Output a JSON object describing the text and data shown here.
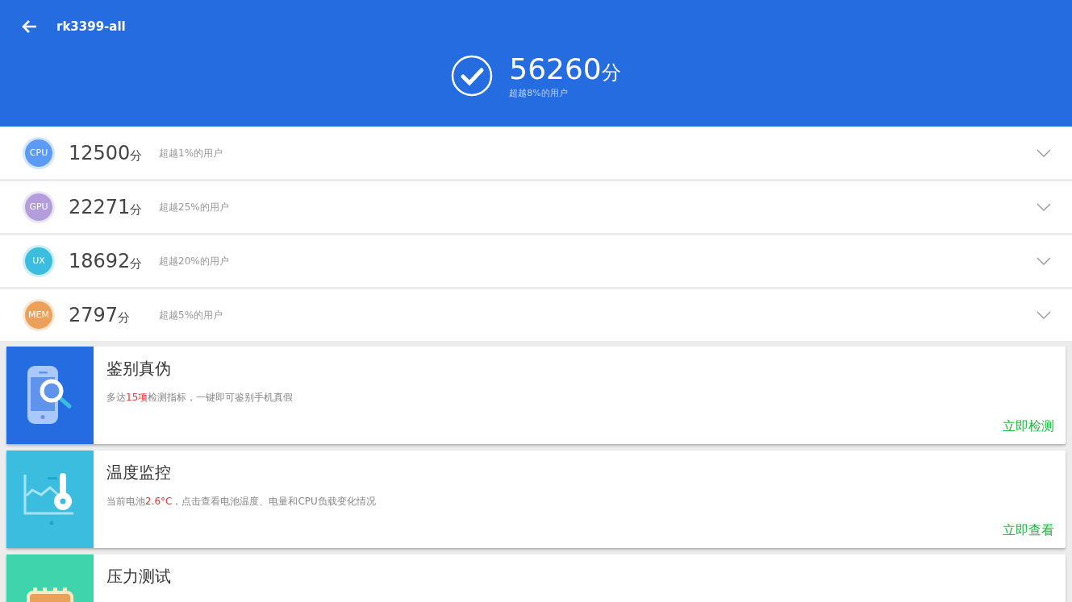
{
  "header": {
    "title": "rk3399-all",
    "total_score": "56260",
    "score_unit": "分",
    "rank": "超越8%的用户"
  },
  "scores": [
    {
      "label": "CPU",
      "color": "#5b9af5",
      "score": "12500",
      "unit": "分",
      "rank": "超越1%的用户"
    },
    {
      "label": "GPU",
      "color": "#b39ddb",
      "score": "22271",
      "unit": "分",
      "rank": "超越25%的用户"
    },
    {
      "label": "UX",
      "color": "#3bbde0",
      "score": "18692",
      "unit": "分",
      "rank": "超越20%的用户"
    },
    {
      "label": "MEM",
      "color": "#eba15a",
      "score": "2797",
      "unit": "分",
      "rank": "超越5%的用户"
    }
  ],
  "cards": [
    {
      "kind": "phone-search",
      "color": "#256ce0",
      "title": "鉴别真伪",
      "description": [
        {
          "text": "多达",
          "highlight": false
        },
        {
          "text": "15项",
          "highlight": true
        },
        {
          "text": "检测指标，一键即可鉴别手机真假",
          "highlight": false
        }
      ],
      "action": "立即检测"
    },
    {
      "kind": "thermometer-chart",
      "color": "#3bbde0",
      "title": "温度监控",
      "description": [
        {
          "text": "当前电池",
          "highlight": false
        },
        {
          "text": "2.6°C",
          "highlight": true
        },
        {
          "text": "，点击查看电池温度、电量和CPU负载变化情况",
          "highlight": false
        }
      ],
      "action": "立即查看"
    },
    {
      "kind": "chip",
      "color": "#40d4ac",
      "title": "压力测试"
    }
  ]
}
